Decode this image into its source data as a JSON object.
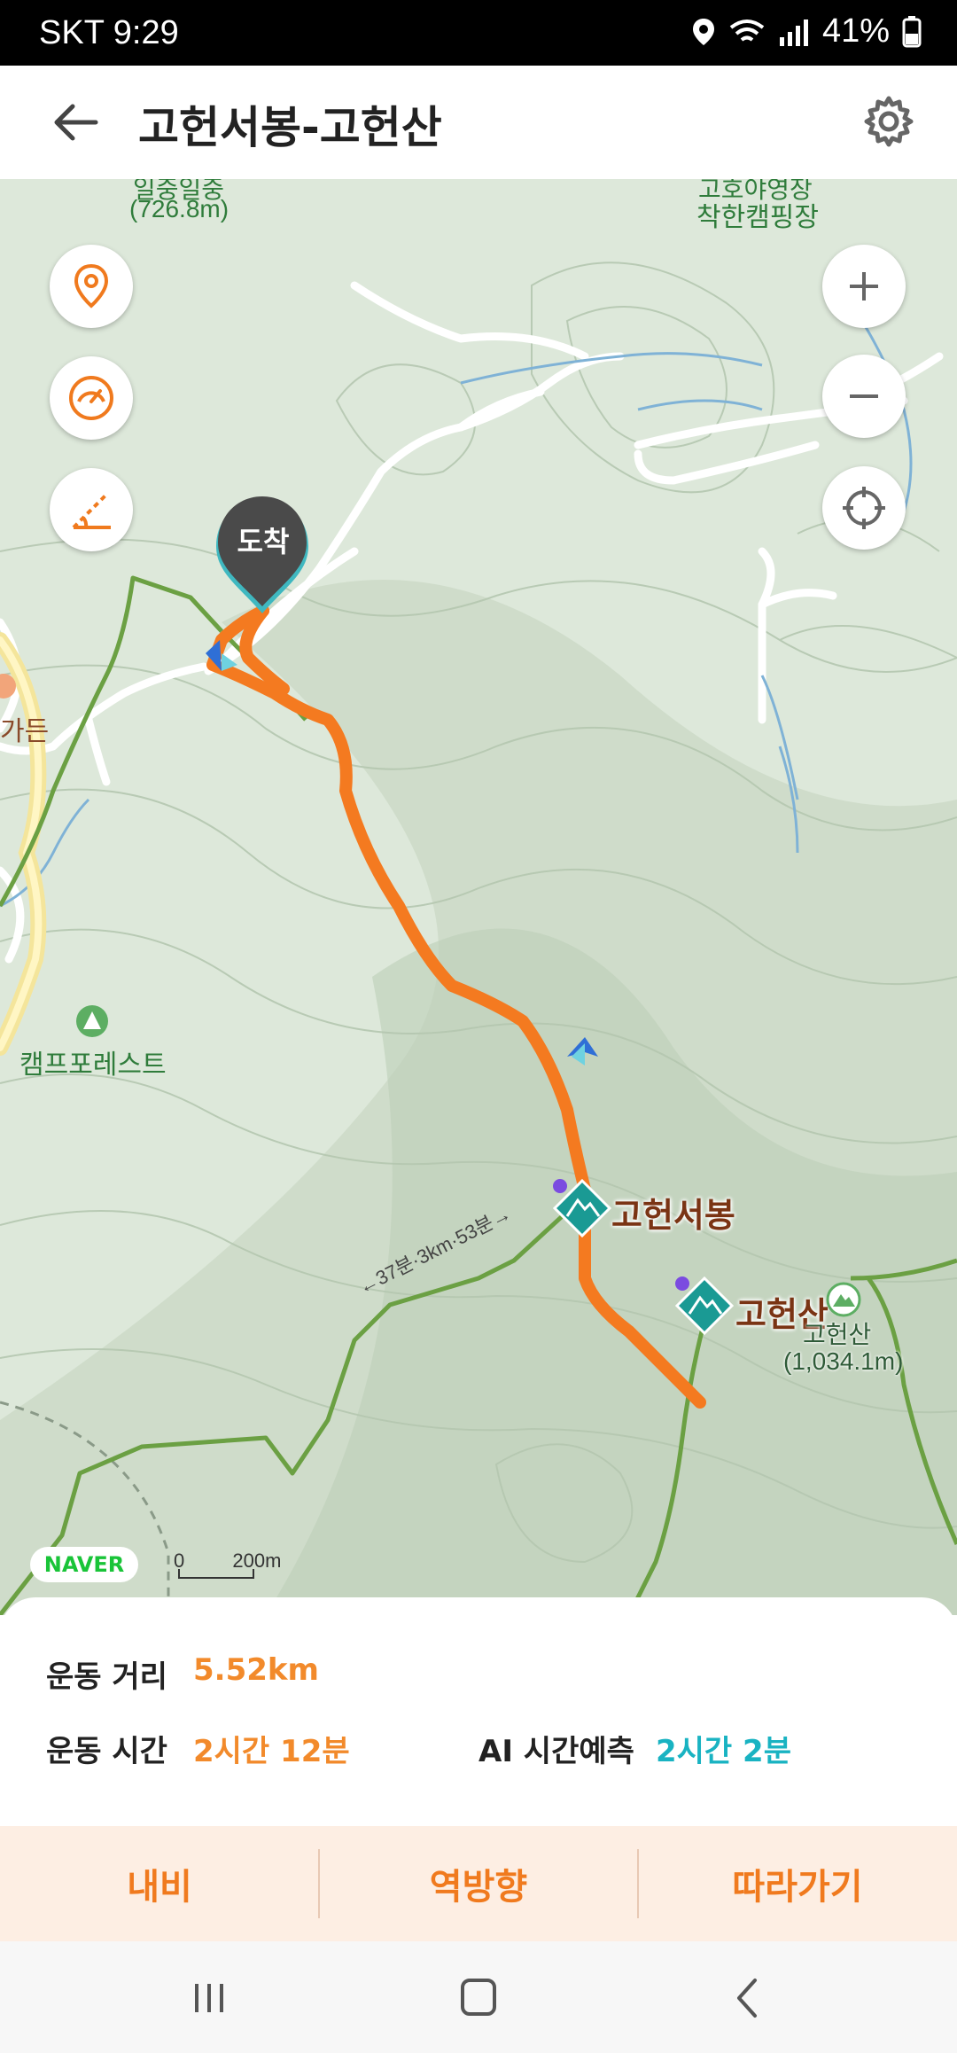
{
  "status_bar": {
    "carrier": "SKT",
    "time": "9:29",
    "battery": "41%"
  },
  "header": {
    "title": "고헌서봉-고헌산",
    "back_icon": "arrow-left-icon",
    "settings_icon": "gear-icon"
  },
  "map": {
    "labels": {
      "top_peak_partial": "일중일중",
      "top_peak_elev": "(726.8m)",
      "campground_partial": "고호야영장",
      "campground": "착한캠핑장",
      "restaurant": "가든",
      "camp_forest": "캠프포레스트",
      "peak1": "고헌서봉",
      "peak2": "고헌산",
      "peak2_small": "고헌산",
      "peak2_elev": "(1,034.1m)",
      "trail_time": "←37분·3km·53분→",
      "arrival": "도착"
    },
    "scale": {
      "zero": "0",
      "distance": "200m"
    },
    "brand": "NAVER",
    "route_color": "#f47a20"
  },
  "summary": {
    "distance_label": "운동 거리",
    "distance_value": "5.52km",
    "time_label": "운동 시간",
    "time_value": "2시간 12분",
    "ai_label": "AI 시간예측",
    "ai_value": "2시간 2분"
  },
  "actions": {
    "navi": "내비",
    "reverse": "역방향",
    "follow": "따라가기"
  }
}
